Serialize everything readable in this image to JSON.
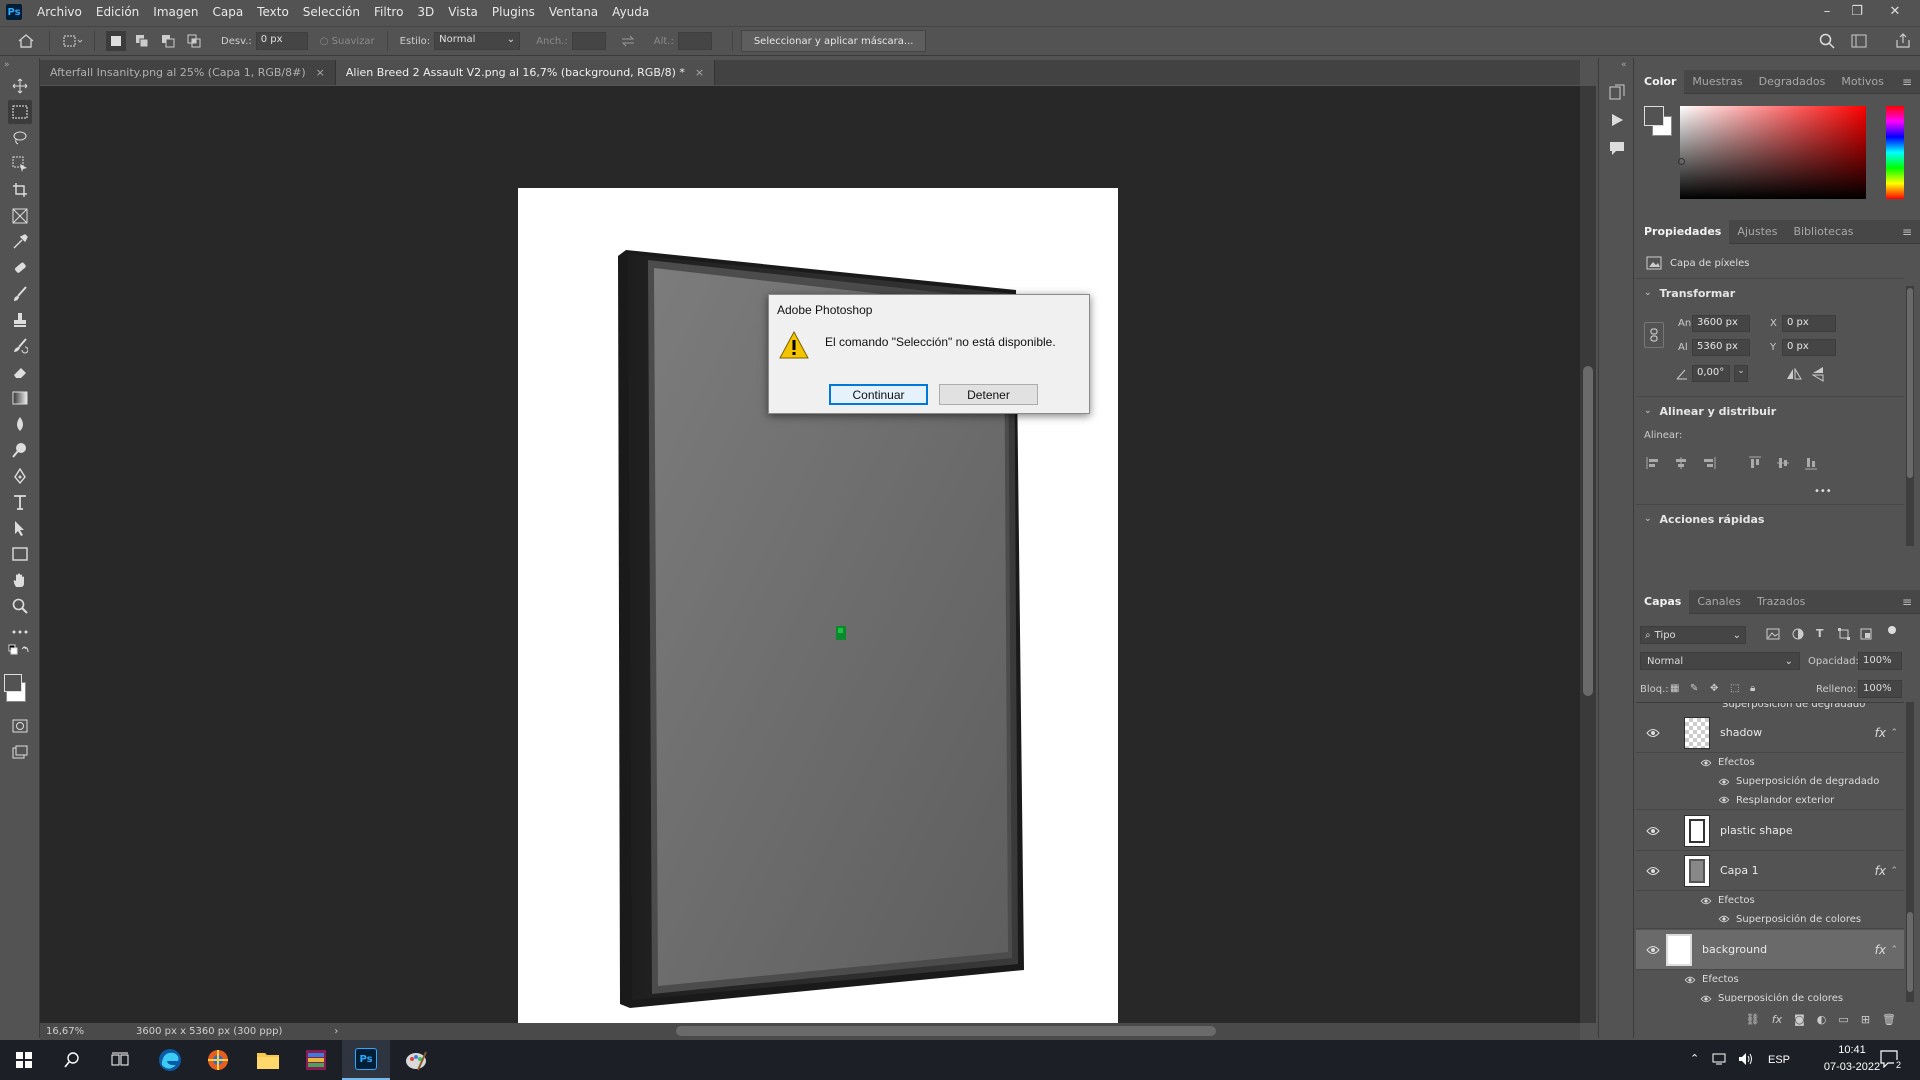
{
  "menubar": {
    "logo": "Ps",
    "items": [
      "Archivo",
      "Edición",
      "Imagen",
      "Capa",
      "Texto",
      "Selección",
      "Filtro",
      "3D",
      "Vista",
      "Plugins",
      "Ventana",
      "Ayuda"
    ]
  },
  "options": {
    "feather_label": "Desv.:",
    "feather_value": "0 px",
    "antialias_label": "Suavizar",
    "style_label": "Estilo:",
    "style_value": "Normal",
    "width_label": "Anch.:",
    "height_label": "Alt.:",
    "mask_button": "Seleccionar y aplicar máscara..."
  },
  "tabs": [
    {
      "label": "Afterfall Insanity.png al 25% (Capa 1, RGB/8#)",
      "close": "×"
    },
    {
      "label": "Alien Breed 2 Assault V2.png al 16,7% (background, RGB/8) *",
      "close": "×"
    }
  ],
  "status": {
    "zoom": "16,67%",
    "docinfo": "3600 px x 5360 px (300 ppp)",
    "arrow": "›"
  },
  "color_panel": {
    "tabs": [
      "Color",
      "Muestras",
      "Degradados",
      "Motivos"
    ]
  },
  "properties": {
    "tabs": [
      "Propiedades",
      "Ajustes",
      "Bibliotecas"
    ],
    "layer_type": "Capa de píxeles",
    "transform_title": "Transformar",
    "w_label": "An",
    "w_value": "3600 px",
    "h_label": "Al",
    "h_value": "5360 px",
    "x_label": "X",
    "x_value": "0 px",
    "y_label": "Y",
    "y_value": "0 px",
    "angle_value": "0,00°",
    "align_title": "Alinear y distribuir",
    "align_label": "Alinear:",
    "more": "•••",
    "quick_title": "Acciones rápidas"
  },
  "layers": {
    "tabs": [
      "Capas",
      "Canales",
      "Trazados"
    ],
    "filter": "Tipo",
    "blend_mode": "Normal",
    "opacity_label": "Opacidad:",
    "opacity_value": "100%",
    "lock_label": "Bloq.:",
    "fill_label": "Relleno:",
    "fill_value": "100%",
    "cut_effect": "Superposición de degradado",
    "items": [
      {
        "name": "shadow",
        "fx": "fx",
        "effects_label": "Efectos",
        "effects": [
          "Superposición de degradado",
          "Resplandor exterior"
        ]
      },
      {
        "name": "plastic shape"
      },
      {
        "name": "Capa 1",
        "fx": "fx",
        "effects_label": "Efectos",
        "effects": [
          "Superposición de colores"
        ]
      },
      {
        "name": "background",
        "fx": "fx",
        "effects_label": "Efectos",
        "effects": [
          "Superposición de colores"
        ]
      }
    ]
  },
  "dialog": {
    "title": "Adobe Photoshop",
    "message": "El comando \"Selección\" no está disponible.",
    "continue_label": "Continuar",
    "stop_label": "Detener"
  },
  "taskbar": {
    "language": "ESP",
    "time": "10:41",
    "date": "07-03-2022",
    "notifications": "2"
  },
  "colors": {
    "accent": "#0078d7",
    "ps_blue": "#31a8ff",
    "warning": "#f5c400"
  }
}
